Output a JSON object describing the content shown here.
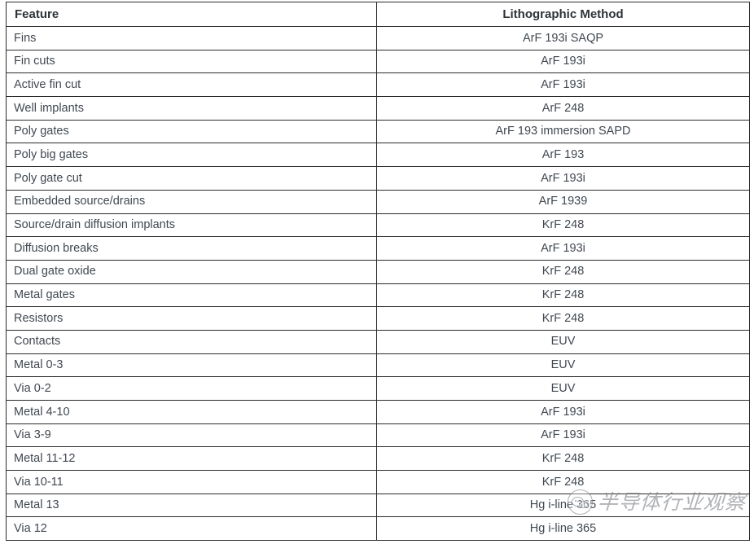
{
  "table": {
    "columns": [
      {
        "key": "feature",
        "label": "Feature",
        "align": "left"
      },
      {
        "key": "method",
        "label": "Lithographic Method",
        "align": "center"
      }
    ],
    "rows": [
      {
        "feature": "Fins",
        "method": "ArF 193i SAQP"
      },
      {
        "feature": "Fin cuts",
        "method": "ArF 193i"
      },
      {
        "feature": "Active fin cut",
        "method": "ArF 193i"
      },
      {
        "feature": "Well implants",
        "method": "ArF 248"
      },
      {
        "feature": "Poly gates",
        "method": "ArF 193 immersion SAPD"
      },
      {
        "feature": "Poly big gates",
        "method": "ArF 193"
      },
      {
        "feature": "Poly gate cut",
        "method": "ArF 193i"
      },
      {
        "feature": "Embedded source/drains",
        "method": "ArF 1939"
      },
      {
        "feature": "Source/drain diffusion implants",
        "method": "KrF 248"
      },
      {
        "feature": "Diffusion breaks",
        "method": "ArF 193i"
      },
      {
        "feature": "Dual gate oxide",
        "method": "KrF 248"
      },
      {
        "feature": "Metal gates",
        "method": "KrF 248"
      },
      {
        "feature": "Resistors",
        "method": "KrF 248"
      },
      {
        "feature": "Contacts",
        "method": "EUV"
      },
      {
        "feature": "Metal 0-3",
        "method": "EUV"
      },
      {
        "feature": "Via 0-2",
        "method": "EUV"
      },
      {
        "feature": "Metal 4-10",
        "method": "ArF 193i"
      },
      {
        "feature": "Via 3-9",
        "method": "ArF 193i"
      },
      {
        "feature": "Metal 11-12",
        "method": "KrF 248"
      },
      {
        "feature": "Via 10-11",
        "method": "KrF 248"
      },
      {
        "feature": "Metal 13",
        "method": "Hg i-line 365"
      },
      {
        "feature": "Via 12",
        "method": "Hg i-line 365"
      }
    ]
  },
  "watermark": {
    "text": "半导体行业观察",
    "logo_icon": "wechat-official-account-icon"
  },
  "colors": {
    "border": "#2b2b2b",
    "text": "#414851",
    "header_text": "#2e3338",
    "background": "#ffffff",
    "watermark_text": "#82868c"
  }
}
